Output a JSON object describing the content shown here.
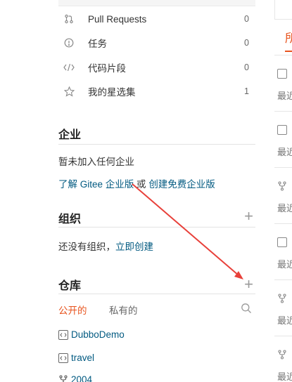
{
  "stats": [
    {
      "label": "Pull Requests",
      "count": "0",
      "icon": "pull-request-icon"
    },
    {
      "label": "任务",
      "count": "0",
      "icon": "info-circle-icon"
    },
    {
      "label": "代码片段",
      "count": "0",
      "icon": "code-icon"
    },
    {
      "label": "我的星选集",
      "count": "1",
      "icon": "star-icon"
    }
  ],
  "enterprise": {
    "title": "企业",
    "empty_text": "暂未加入任何企业",
    "learn_link": "了解 Gitee 企业版",
    "or_text": "或",
    "create_link": "创建免费企业版"
  },
  "organization": {
    "title": "组织",
    "empty_text": "还没有组织，",
    "create_link": "立即创建"
  },
  "repositories": {
    "title": "仓库",
    "tabs": [
      "公开的",
      "私有的"
    ],
    "items": [
      {
        "name": "DubboDemo",
        "icon": "code-repo-icon"
      },
      {
        "name": "travel",
        "icon": "code-repo-icon"
      },
      {
        "name": "2004",
        "icon": "fork-icon"
      }
    ]
  },
  "right_column": {
    "header": "所",
    "items": [
      {
        "icon": "code-repo-icon",
        "text": "最近"
      },
      {
        "icon": "code-repo-icon",
        "text": "最近"
      },
      {
        "icon": "fork-icon",
        "text": "最近"
      },
      {
        "icon": "code-repo-icon",
        "text": "最近"
      },
      {
        "icon": "fork-icon",
        "text": "最近"
      },
      {
        "icon": "fork-icon",
        "text": "最近"
      }
    ]
  },
  "colors": {
    "accent": "#e8541e",
    "link": "#005980",
    "annotation_arrow": "#e8403a"
  }
}
